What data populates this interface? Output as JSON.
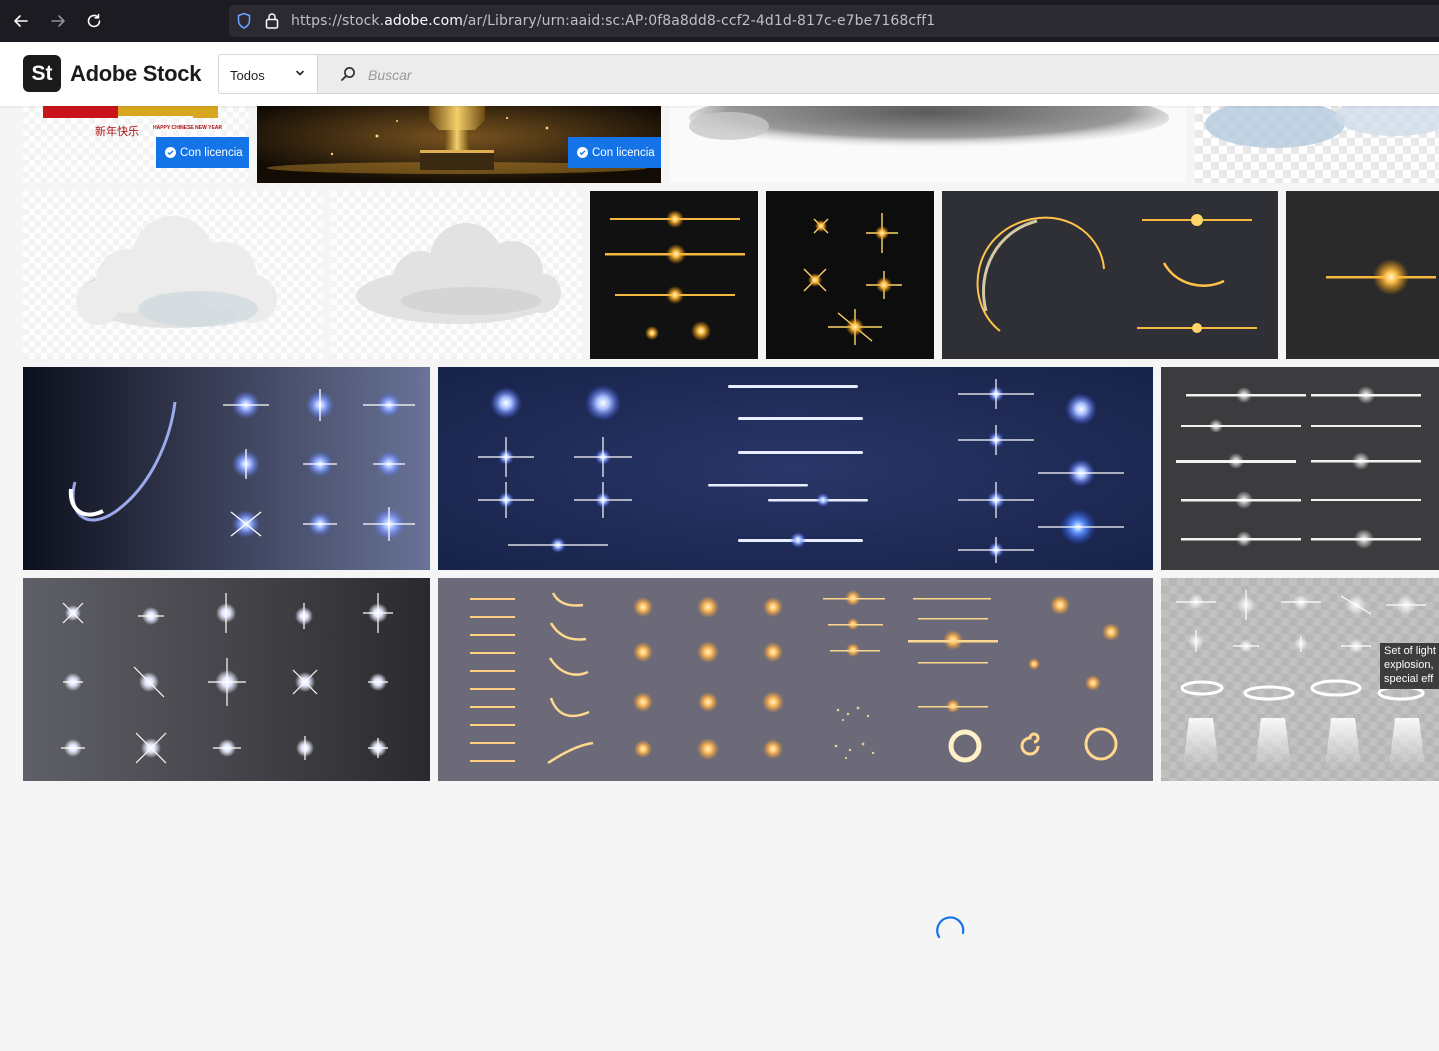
{
  "browser": {
    "url_prefix": "https://stock.",
    "url_domain": "adobe.com",
    "url_path": "/ar/Library/urn:aaid:sc:AP:0f8a8dd8-ccf2-4d1d-817c-e7be7168cff1"
  },
  "header": {
    "logo_mark": "St",
    "logo_name": "Adobe Stock",
    "filter_selected": "Todos",
    "search_placeholder": "Buscar"
  },
  "badges": {
    "licensed_label": "Con licencia"
  },
  "tooltip": {
    "line1": "Set of light",
    "line2": "explosion,",
    "line3": "special eff"
  },
  "partial_tile_text": {
    "chinese": "新年快乐",
    "english": "HAPPY CHINESE NEW YEAR"
  },
  "colors": {
    "accent": "#1473e6",
    "chrome_bg": "#1c1b22",
    "page_bg": "#f5f5f5"
  }
}
